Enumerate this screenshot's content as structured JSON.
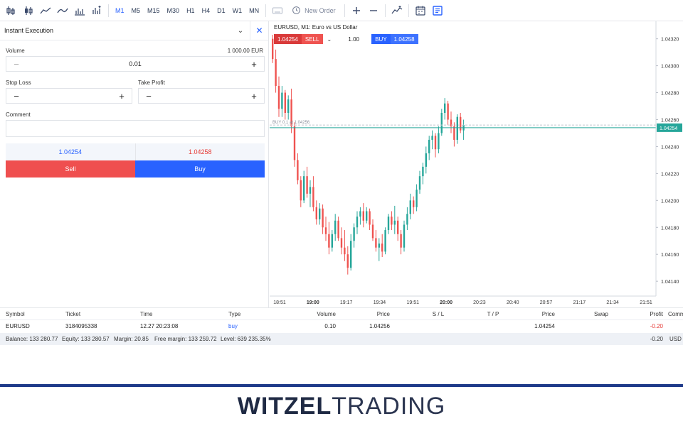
{
  "toolbar": {
    "timeframes": [
      "M1",
      "M5",
      "M15",
      "M30",
      "H1",
      "H4",
      "D1",
      "W1",
      "MN"
    ],
    "active_timeframe": "M1",
    "new_order_label": "New Order"
  },
  "order_panel": {
    "title": "Instant Execution",
    "volume_label": "Volume",
    "volume_value_info": "1 000.00 EUR",
    "volume_value": "0.01",
    "stop_loss_label": "Stop Loss",
    "take_profit_label": "Take Profit",
    "comment_label": "Comment",
    "bid_price": "1.04254",
    "ask_price": "1.04258",
    "sell_label": "Sell",
    "buy_label": "Buy"
  },
  "chart": {
    "title": "EURUSD, M1: Euro vs US Dollar",
    "sell_price": "1.04254",
    "sell_label": "SELL",
    "quantity": "1.00",
    "buy_label": "BUY",
    "buy_price": "1.04258",
    "position_line_label": "BUY 0.1 at 1.04256",
    "current_price_tag": "1.04254",
    "colors": {
      "up": "#26a69a",
      "down": "#ef5350",
      "price_line": "#26a69a"
    }
  },
  "chart_data": {
    "type": "candlestick",
    "title": "EURUSD, M1: Euro vs US Dollar",
    "x_tick_labels": [
      "18:51",
      "19:00",
      "19:17",
      "19:34",
      "19:51",
      "20:00",
      "20:23",
      "20:40",
      "20:57",
      "21:17",
      "21:34",
      "21:51"
    ],
    "y_tick_labels": [
      "1.04320",
      "1.04300",
      "1.04280",
      "1.04260",
      "1.04240",
      "1.04220",
      "1.04200",
      "1.04180",
      "1.04160",
      "1.04140"
    ],
    "ylim": [
      1.04129,
      1.04333
    ],
    "current_price": 1.04254,
    "position_price": 1.04256,
    "candles": [
      {
        "o": 1.0432,
        "h": 1.04323,
        "l": 1.04302,
        "c": 1.04305
      },
      {
        "o": 1.04305,
        "h": 1.04312,
        "l": 1.0428,
        "c": 1.04285
      },
      {
        "o": 1.04285,
        "h": 1.04292,
        "l": 1.04262,
        "c": 1.04268
      },
      {
        "o": 1.04268,
        "h": 1.04285,
        "l": 1.04262,
        "c": 1.0428
      },
      {
        "o": 1.0428,
        "h": 1.04282,
        "l": 1.0426,
        "c": 1.04265
      },
      {
        "o": 1.04265,
        "h": 1.04278,
        "l": 1.0426,
        "c": 1.04275
      },
      {
        "o": 1.04275,
        "h": 1.04283,
        "l": 1.0425,
        "c": 1.04255
      },
      {
        "o": 1.04255,
        "h": 1.04258,
        "l": 1.04225,
        "c": 1.0423
      },
      {
        "o": 1.0423,
        "h": 1.04235,
        "l": 1.04212,
        "c": 1.04215
      },
      {
        "o": 1.04215,
        "h": 1.04218,
        "l": 1.04195,
        "c": 1.042
      },
      {
        "o": 1.042,
        "h": 1.04222,
        "l": 1.04198,
        "c": 1.04218
      },
      {
        "o": 1.04218,
        "h": 1.04225,
        "l": 1.04202,
        "c": 1.04205
      },
      {
        "o": 1.04205,
        "h": 1.04215,
        "l": 1.04195,
        "c": 1.0421
      },
      {
        "o": 1.0421,
        "h": 1.04218,
        "l": 1.04192,
        "c": 1.04195
      },
      {
        "o": 1.04195,
        "h": 1.042,
        "l": 1.04182,
        "c": 1.04186
      },
      {
        "o": 1.04186,
        "h": 1.04198,
        "l": 1.04182,
        "c": 1.04194
      },
      {
        "o": 1.04194,
        "h": 1.04197,
        "l": 1.04175,
        "c": 1.0418
      },
      {
        "o": 1.0418,
        "h": 1.04188,
        "l": 1.0417,
        "c": 1.04175
      },
      {
        "o": 1.04175,
        "h": 1.04184,
        "l": 1.0416,
        "c": 1.04165
      },
      {
        "o": 1.04165,
        "h": 1.04178,
        "l": 1.04162,
        "c": 1.04175
      },
      {
        "o": 1.04175,
        "h": 1.0419,
        "l": 1.0417,
        "c": 1.04185
      },
      {
        "o": 1.04185,
        "h": 1.04188,
        "l": 1.0417,
        "c": 1.04172
      },
      {
        "o": 1.04172,
        "h": 1.0418,
        "l": 1.0416,
        "c": 1.04165
      },
      {
        "o": 1.04165,
        "h": 1.04178,
        "l": 1.04155,
        "c": 1.0416
      },
      {
        "o": 1.0416,
        "h": 1.04166,
        "l": 1.04145,
        "c": 1.0415
      },
      {
        "o": 1.0415,
        "h": 1.04175,
        "l": 1.04148,
        "c": 1.0417
      },
      {
        "o": 1.0417,
        "h": 1.04183,
        "l": 1.04165,
        "c": 1.0418
      },
      {
        "o": 1.0418,
        "h": 1.04192,
        "l": 1.04175,
        "c": 1.04188
      },
      {
        "o": 1.04188,
        "h": 1.04195,
        "l": 1.04182,
        "c": 1.04192
      },
      {
        "o": 1.04192,
        "h": 1.04198,
        "l": 1.0418,
        "c": 1.04185
      },
      {
        "o": 1.04185,
        "h": 1.04195,
        "l": 1.04183,
        "c": 1.04192
      },
      {
        "o": 1.04192,
        "h": 1.04194,
        "l": 1.04178,
        "c": 1.04182
      },
      {
        "o": 1.04182,
        "h": 1.04186,
        "l": 1.0417,
        "c": 1.04172
      },
      {
        "o": 1.04172,
        "h": 1.04178,
        "l": 1.04162,
        "c": 1.04165
      },
      {
        "o": 1.04165,
        "h": 1.04172,
        "l": 1.04155,
        "c": 1.04168
      },
      {
        "o": 1.04168,
        "h": 1.04175,
        "l": 1.04158,
        "c": 1.04162
      },
      {
        "o": 1.04162,
        "h": 1.0418,
        "l": 1.0416,
        "c": 1.04178
      },
      {
        "o": 1.04178,
        "h": 1.0419,
        "l": 1.04175,
        "c": 1.04188
      },
      {
        "o": 1.04188,
        "h": 1.04192,
        "l": 1.04178,
        "c": 1.04182
      },
      {
        "o": 1.04182,
        "h": 1.04196,
        "l": 1.04175,
        "c": 1.04185
      },
      {
        "o": 1.04185,
        "h": 1.04188,
        "l": 1.0417,
        "c": 1.04175
      },
      {
        "o": 1.04175,
        "h": 1.04178,
        "l": 1.0416,
        "c": 1.04165
      },
      {
        "o": 1.04165,
        "h": 1.04185,
        "l": 1.04162,
        "c": 1.04182
      },
      {
        "o": 1.04182,
        "h": 1.04195,
        "l": 1.04178,
        "c": 1.0419
      },
      {
        "o": 1.0419,
        "h": 1.04205,
        "l": 1.04186,
        "c": 1.042
      },
      {
        "o": 1.042,
        "h": 1.04203,
        "l": 1.0419,
        "c": 1.04195
      },
      {
        "o": 1.04195,
        "h": 1.04212,
        "l": 1.04192,
        "c": 1.04208
      },
      {
        "o": 1.04208,
        "h": 1.04222,
        "l": 1.04205,
        "c": 1.04218
      },
      {
        "o": 1.04218,
        "h": 1.04228,
        "l": 1.04212,
        "c": 1.04225
      },
      {
        "o": 1.04225,
        "h": 1.0424,
        "l": 1.0422,
        "c": 1.04235
      },
      {
        "o": 1.04235,
        "h": 1.04248,
        "l": 1.0423,
        "c": 1.04245
      },
      {
        "o": 1.04245,
        "h": 1.04252,
        "l": 1.04238,
        "c": 1.04248
      },
      {
        "o": 1.04248,
        "h": 1.0425,
        "l": 1.04232,
        "c": 1.04238
      },
      {
        "o": 1.04238,
        "h": 1.04255,
        "l": 1.04235,
        "c": 1.0425
      },
      {
        "o": 1.0425,
        "h": 1.04268,
        "l": 1.04248,
        "c": 1.04265
      },
      {
        "o": 1.04265,
        "h": 1.04276,
        "l": 1.0426,
        "c": 1.04272
      },
      {
        "o": 1.04272,
        "h": 1.04274,
        "l": 1.04256,
        "c": 1.0426
      },
      {
        "o": 1.0426,
        "h": 1.04266,
        "l": 1.0425,
        "c": 1.04255
      },
      {
        "o": 1.04255,
        "h": 1.04258,
        "l": 1.0424,
        "c": 1.04245
      },
      {
        "o": 1.04245,
        "h": 1.04264,
        "l": 1.04242,
        "c": 1.04262
      },
      {
        "o": 1.04262,
        "h": 1.04265,
        "l": 1.0425,
        "c": 1.04252
      },
      {
        "o": 1.04252,
        "h": 1.0426,
        "l": 1.04245,
        "c": 1.04256
      }
    ]
  },
  "positions": {
    "columns": [
      "Symbol",
      "Ticket",
      "Time",
      "Type",
      "Volume",
      "Price",
      "S / L",
      "T / P",
      "Price",
      "Swap",
      "Profit",
      "Comm"
    ],
    "rows": [
      {
        "symbol": "EURUSD",
        "ticket": "3184095338",
        "time": "12.27 20:23:08",
        "type": "buy",
        "volume": "0.10",
        "price": "1.04256",
        "sl": "",
        "tp": "",
        "current_price": "1.04254",
        "swap": "",
        "profit": "-0.20"
      }
    ],
    "account": {
      "balance": "Balance: 133 280.77",
      "equity": "Equity: 133 280.57",
      "margin": "Margin: 20.85",
      "free_margin": "Free margin: 133 259.72",
      "level": "Level: 639 235.35%",
      "total_profit": "-0.20",
      "currency": "USD"
    }
  },
  "footer": {
    "logo_bold": "WITZEL",
    "logo_light": "TRADING"
  }
}
